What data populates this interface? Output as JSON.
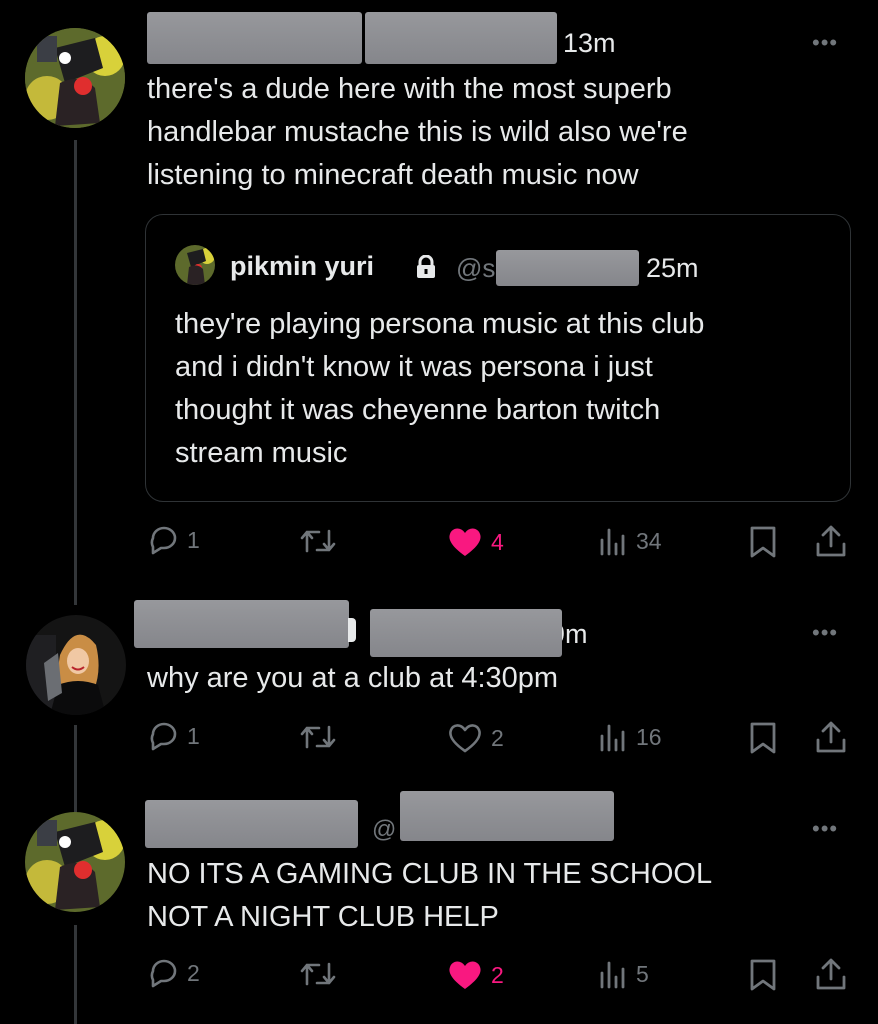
{
  "tweets": [
    {
      "time": "13m",
      "text": "there's a dude here with the most superb\nhandlebar mustache this is wild also we're\nlistening to minecraft death music now",
      "quote": {
        "name": "pikmin yuri",
        "handle": "@s",
        "time": "25m",
        "text": "they're playing persona music at this club\nand i didn't know it was persona i just\nthought it was cheyenne barton twitch\nstream music"
      },
      "replies": "1",
      "likes": "4",
      "views": "34",
      "liked": true
    },
    {
      "time": "9m",
      "text": "why are you at a club at 4:30pm",
      "replies": "1",
      "likes": "2",
      "views": "16",
      "liked": false
    },
    {
      "handle_prefix": "@",
      "text": "NO ITS A GAMING CLUB IN THE SCHOOL\nNOT A NIGHT CLUB HELP",
      "replies": "2",
      "likes": "2",
      "views": "5",
      "liked": true
    }
  ],
  "more_label": "•••",
  "icons": {
    "reply": "reply-icon",
    "retweet": "retweet-icon",
    "like": "heart-icon",
    "views": "views-icon",
    "bookmark": "bookmark-icon",
    "share": "share-icon",
    "lock": "lock-icon"
  },
  "colors": {
    "like": "#f91880",
    "muted": "#71767b",
    "text": "#e7e9ea",
    "background": "#000000"
  }
}
